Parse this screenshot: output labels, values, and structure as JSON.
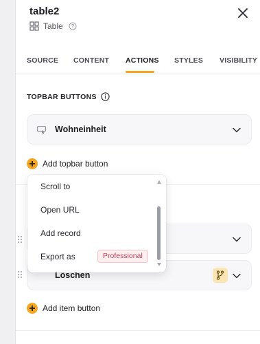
{
  "header": {
    "title": "table2",
    "component_type": "Table"
  },
  "tabs": [
    {
      "label": "SOURCE",
      "active": false
    },
    {
      "label": "CONTENT",
      "active": false
    },
    {
      "label": "ACTIONS",
      "active": true
    },
    {
      "label": "STYLES",
      "active": false
    },
    {
      "label": "VISIBILITY",
      "active": false
    }
  ],
  "topbar": {
    "section_title": "TOPBAR BUTTONS",
    "buttons": [
      {
        "label": "Wohneinheit",
        "icon": "button-icon"
      }
    ],
    "add_label": "Add topbar button"
  },
  "dropdown": {
    "options": [
      {
        "label": "Scroll to"
      },
      {
        "label": "Open URL"
      },
      {
        "label": "Add record"
      },
      {
        "label": "Export as",
        "badge": "Professional"
      }
    ]
  },
  "item_buttons": {
    "buttons": [
      {
        "label": ""
      },
      {
        "label": "Löschen",
        "badge_icon": "branch-icon"
      }
    ],
    "add_label": "Add item button"
  },
  "colors": {
    "accent": "#f5a623",
    "badge_bg": "#fdeef0",
    "badge_text": "#c0405a",
    "branch_badge": "#fbe5b5"
  }
}
